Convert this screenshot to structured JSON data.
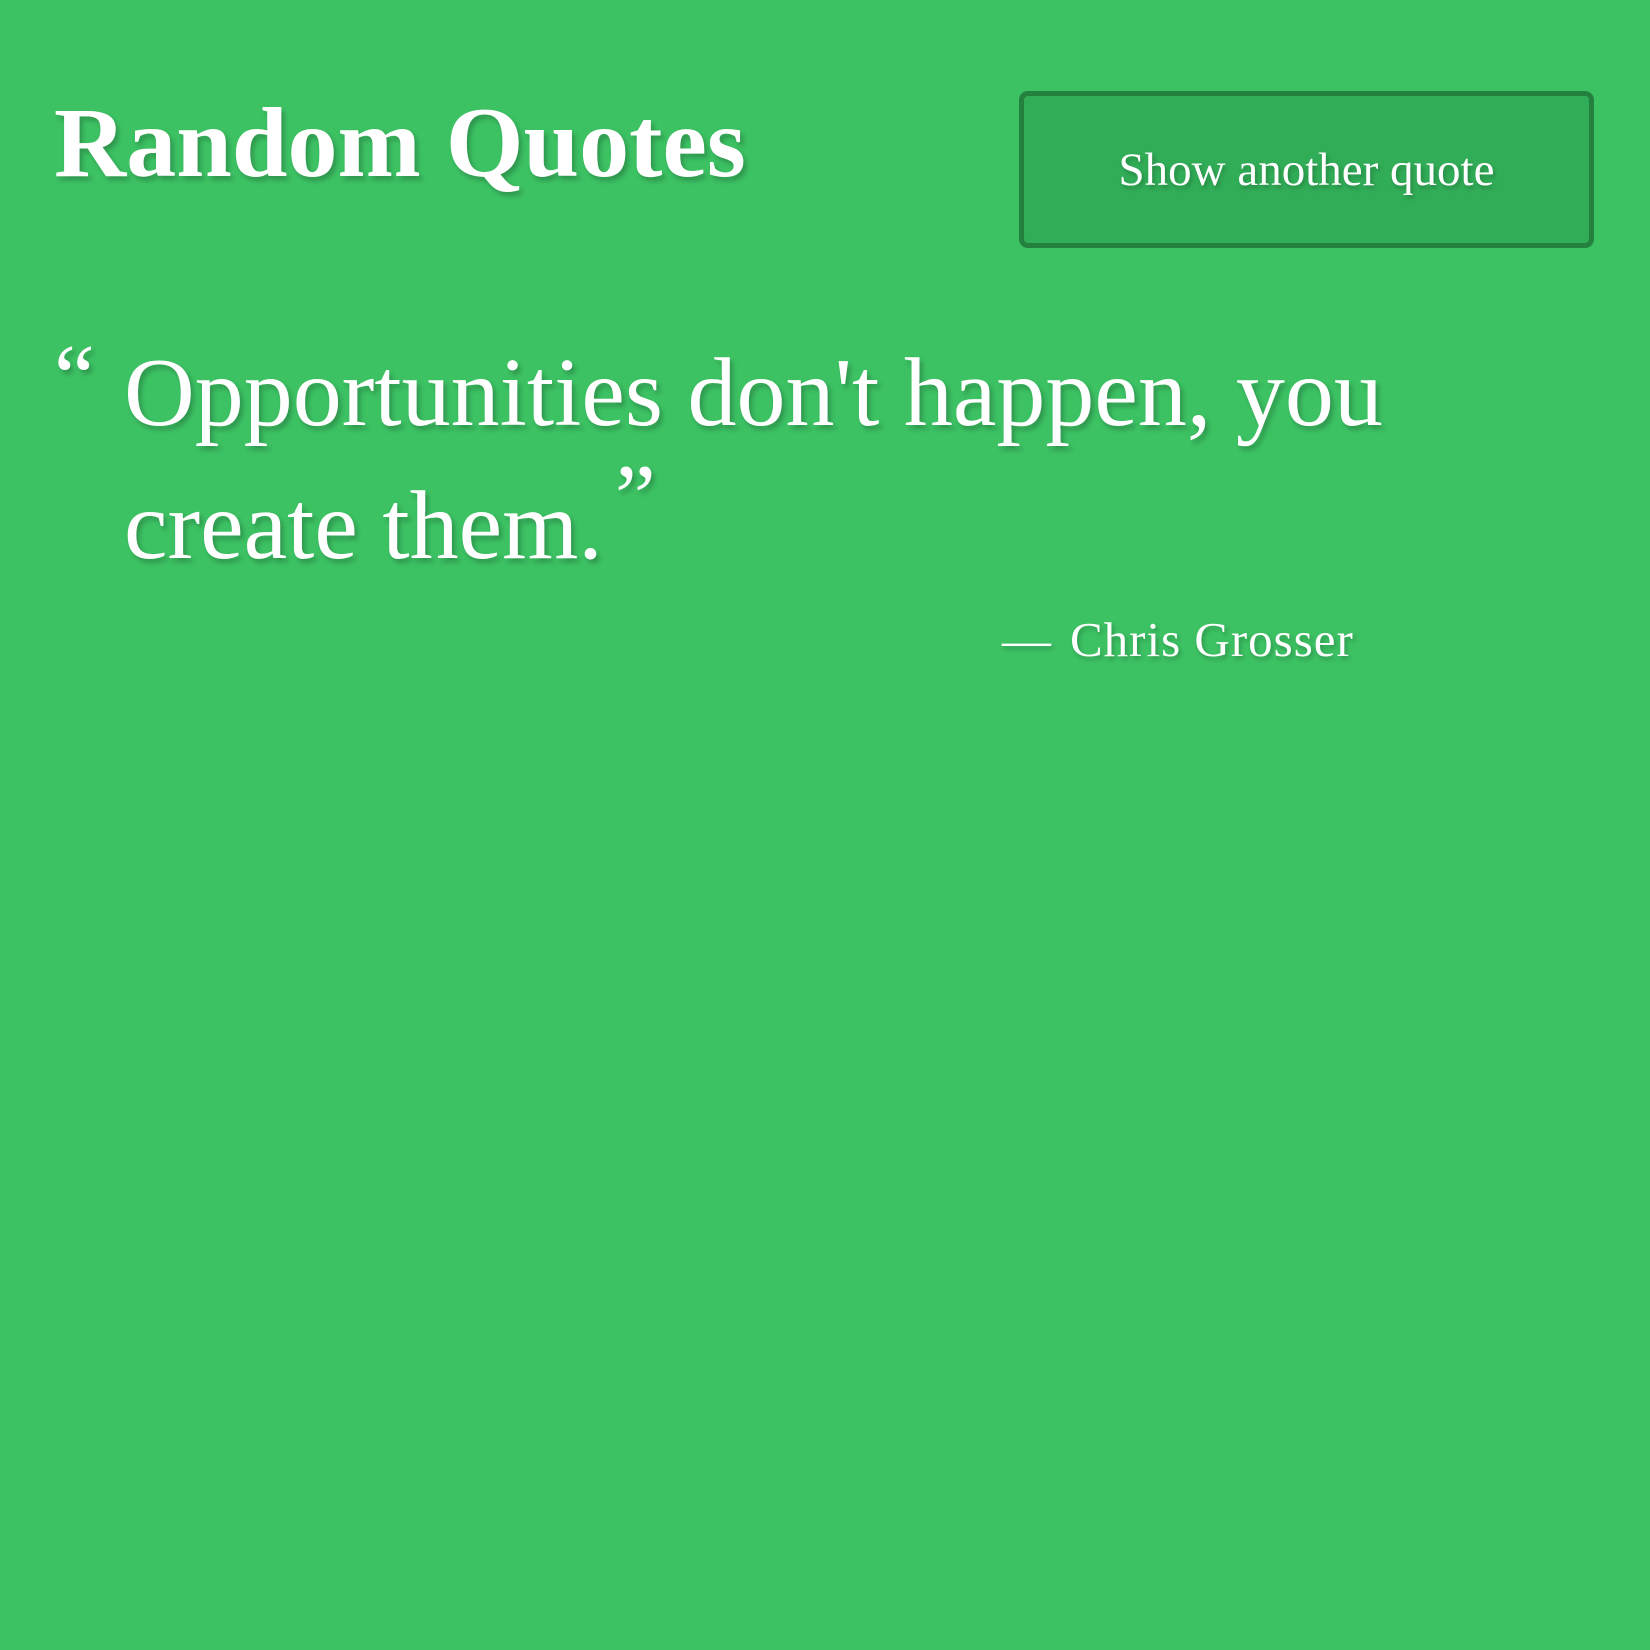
{
  "colors": {
    "background": "#3cc163",
    "button_bg": "#31ad57",
    "button_border": "#23803f",
    "text": "#ffffff"
  },
  "header": {
    "title": "Random Quotes",
    "button_label": "Show another quote"
  },
  "quote": {
    "open_mark": "“",
    "text": "Opportunities don't happen, you create them.",
    "close_mark": "”",
    "author_dash": "—",
    "author": "Chris Grosser"
  }
}
